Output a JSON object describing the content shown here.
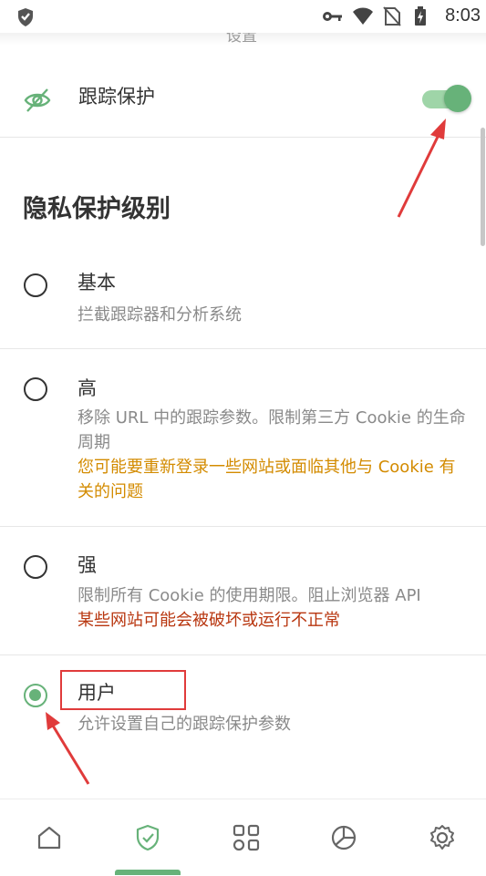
{
  "status_bar": {
    "time": "8:03",
    "icons": [
      "shield-icon",
      "key-icon",
      "wifi-icon",
      "no-sim-icon",
      "battery-charging-icon"
    ]
  },
  "peek_text": "设置",
  "tracking": {
    "label": "跟踪保护",
    "icon": "eye-off-icon",
    "toggle_on": true
  },
  "section": {
    "title": "隐私保护级别"
  },
  "options": [
    {
      "title": "基本",
      "desc": "拦截跟踪器和分析系统",
      "selected": false
    },
    {
      "title": "高",
      "desc": "移除 URL 中的跟踪参数。限制第三方 Cookie 的生命周期",
      "warning": "您可能要重新登录一些网站或面临其他与 Cookie 有关的问题",
      "selected": false
    },
    {
      "title": "强",
      "desc": "限制所有 Cookie 的使用期限。阻止浏览器 API",
      "warning": "某些网站可能会被破坏或运行不正常",
      "selected": false
    },
    {
      "title": "用户",
      "desc": "允许设置自己的跟踪保护参数",
      "selected": true
    }
  ],
  "bottom_nav": {
    "items": [
      "home-icon",
      "protection-icon",
      "apps-icon",
      "stats-icon",
      "settings-icon"
    ],
    "active": "protection-icon"
  },
  "colors": {
    "accent": "#67b279",
    "warning_orange": "#d38b00",
    "warning_red": "#b8360f",
    "annotation_red": "#e03b3b"
  }
}
